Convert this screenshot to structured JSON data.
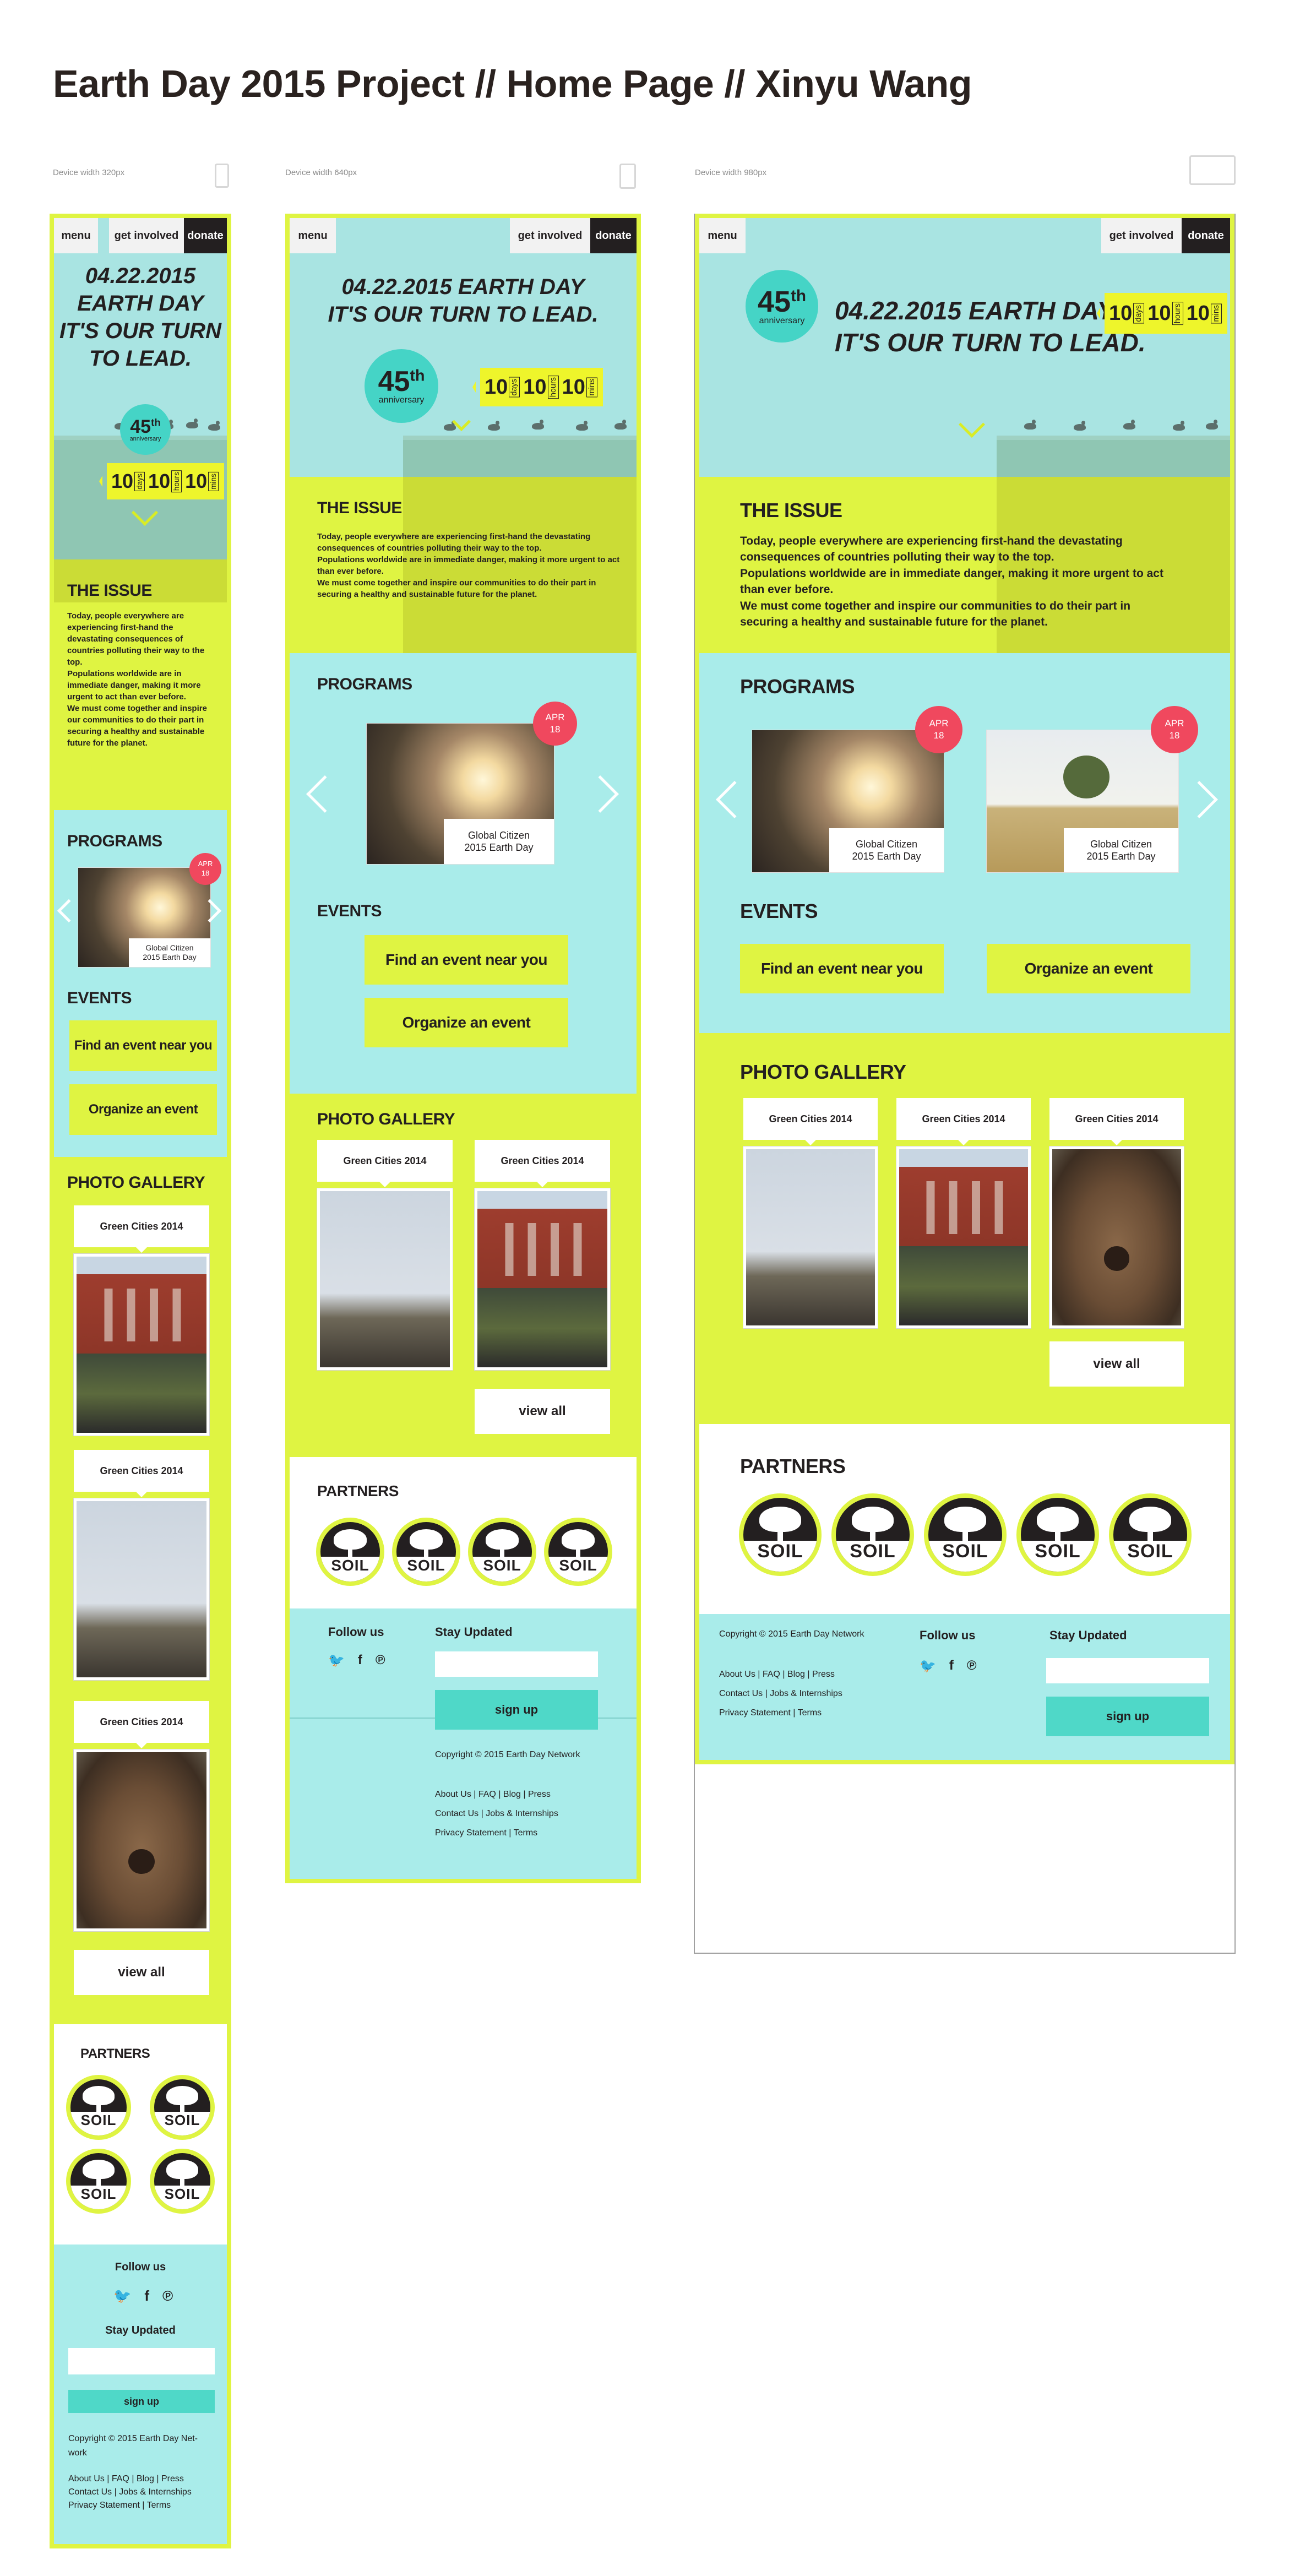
{
  "title": "Earth Day 2015 Project // Home Page // Xinyu Wang",
  "labels": {
    "w320": "Device width 320px",
    "w640": "Device width 640px",
    "w980": "Device width 980px"
  },
  "nav": {
    "menu": "menu",
    "get_involved": "get involved",
    "donate": "donate"
  },
  "hero": {
    "date": "04.22.2015",
    "line1": "EARTH DAY",
    "line2": "IT'S OUR TURN",
    "line3": "TO LEAD.",
    "line_a": "04.22.2015  EARTH DAY",
    "line_b": "IT'S OUR TURN TO LEAD.",
    "anniv_num": "45",
    "anniv_sup": "th",
    "anniv_word": "anniversary",
    "count": [
      {
        "num": "10",
        "unit": "days"
      },
      {
        "num": "10",
        "unit": "hours"
      },
      {
        "num": "10",
        "unit": "mins"
      }
    ]
  },
  "issue": {
    "title": "THE ISSUE",
    "p1": "Today, people everywhere are experiencing first-hand the devastating consequences of countries polluting their way to the top.",
    "p2": "Populations worldwide are in immediate danger, making it more urgent to act than ever before.",
    "p3": "We must come together and inspire our communities to do their part in securing a healthy and sustainable future for the planet."
  },
  "programs": {
    "title": "PROGRAMS",
    "date_month": "APR",
    "date_day": "18",
    "card_line1": "Global Citizen",
    "card_line2": "2015 Earth Day"
  },
  "events": {
    "title": "EVENTS",
    "find": "Find an event near you",
    "organize": "Organize an event"
  },
  "gallery": {
    "title": "PHOTO GALLERY",
    "tag": "Green Cities 2014",
    "view_all": "view all"
  },
  "partners": {
    "title": "PARTNERS",
    "logo": "SOIL"
  },
  "footer": {
    "follow": "Follow us",
    "stay": "Stay Updated",
    "signup": "sign up",
    "copyright": "Copyright © 2015 Earth Day Network",
    "copyright_a": "Copyright © 2015 Earth Day Net-",
    "copyright_b": "work",
    "links1": "About Us  |  FAQ  |  Blog  |  Press",
    "links2": "Contact Us  |  Jobs & Internships",
    "links3": "Privacy Statement  |  Terms",
    "icons": [
      "twitter-icon",
      "facebook-icon",
      "pinterest-icon"
    ]
  },
  "colors": {
    "lime": "#dff442",
    "aqua": "#a9ecea",
    "teal": "#45d4c6",
    "red": "#f0485e",
    "dark": "#231f20"
  }
}
